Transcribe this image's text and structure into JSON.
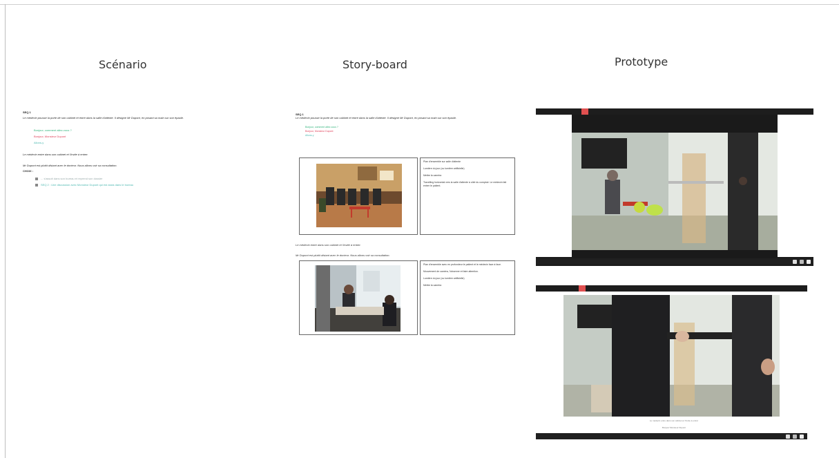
{
  "columns": {
    "scenario": "Scénario",
    "storyboard": "Story-board",
    "prototype": "Prototype"
  },
  "scenario": {
    "heading": "SEQ 1",
    "intro": "Le médecin pousse la porte de son cabinet et entre dans la salle d'attente. Il désigne Mr Dupont, en posant sa main sur son épaule.",
    "choices": [
      "Bonjour, comment allez-vous ?",
      "Bonjour, Monsieur Dupont",
      "Allons-y"
    ],
    "line2": "Le médecin entre dans son cabinet et l'invite à entrer.",
    "line3": "Mr Dupont est plutôt distant avec le docteur. Nous allons voir sa consultation.",
    "choice_label": "CHOIX :",
    "links": [
      "... s'assoit dans son bureau et reprend son dossier",
      "SEQ 2 : Une discussion avec Monsieur Dupont qui est assis dans le bureau"
    ]
  },
  "storyboard": {
    "heading": "SEQ 1",
    "intro": "Le médecin pousse la porte de son cabinet et entre dans la salle d'attente. Il désigne Mr Dupont, en posant sa main sur son épaule.",
    "choices": [
      "Bonjour, comment allez-vous ?",
      "Bonjour, Monsieur Dupont",
      "Allons-y"
    ],
    "notes1": [
      "Plan d'ensemble sur salle d'attente",
      "Lumière du jour (ou lumière artificielle)",
      "Mettre la caméra",
      "Travelling horizontal vers la salle d'attente à côté du comptoir. Le médecin fait entrer le patient."
    ],
    "middle1": "Le médecin entre dans son cabinet et l'invite à entrer.",
    "middle2": "Mr Dupont est plutôt distant avec le docteur. Nous allons voir sa consultation.",
    "notes2": [
      "Plan d'ensemble avec en profondeur le patient et le médecin face à face.",
      "Mouvement de caméra, l'observer et faire attention.",
      "Lumière du jour (ou lumière artificielle)",
      "Mettre la caméra"
    ]
  },
  "prototype": {
    "caption1": "Le médecin entre dans son cabinet et l'invite à entrer",
    "caption2": "Bonjour Monsieur Dupont"
  }
}
